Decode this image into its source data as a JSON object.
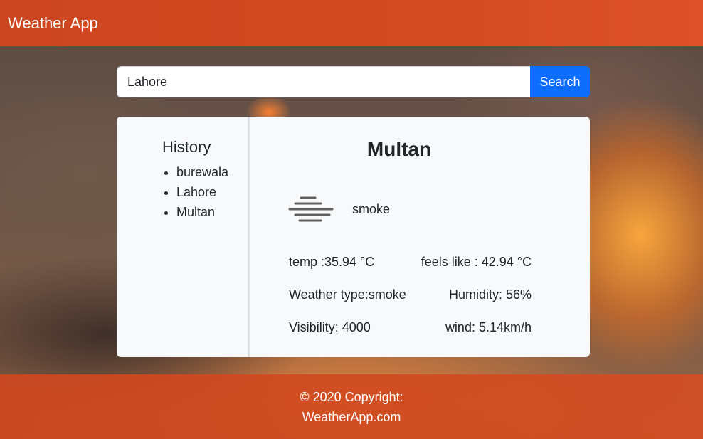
{
  "navbar": {
    "brand": "Weather App"
  },
  "search": {
    "value": "Lahore",
    "button_label": "Search"
  },
  "history": {
    "title": "History",
    "items": [
      "burewala",
      "Lahore",
      "Multan"
    ]
  },
  "weather": {
    "city": "Multan",
    "icon": "mist-smoke-icon",
    "description": "smoke",
    "temp": "temp :35.94 °C",
    "feels_like": "feels like : 42.94 °C",
    "weather_type": "Weather type:smoke",
    "humidity": "Humidity: 56%",
    "visibility": "Visibility: 4000",
    "wind": "wind: 5.14km/h"
  },
  "footer": {
    "copyright": "© 2020 Copyright:",
    "site": "WeatherApp.com"
  },
  "colors": {
    "navbar": "#d44a21",
    "search_button": "#0d6efd",
    "card": "#f8f9fa"
  }
}
